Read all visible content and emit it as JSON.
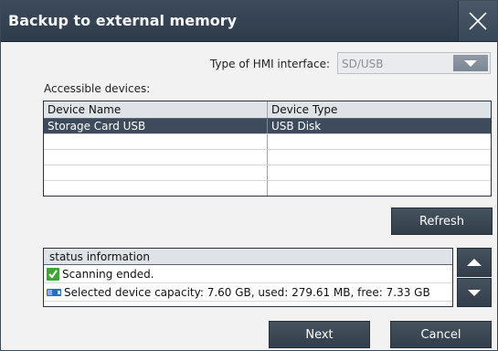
{
  "window": {
    "title": "Backup to external memory"
  },
  "hmi": {
    "label": "Type of HMI interface:",
    "value": "SD/USB"
  },
  "devices": {
    "label": "Accessible devices:",
    "columns": [
      "Device Name",
      "Device Type"
    ],
    "rows": [
      {
        "name": "Storage Card USB",
        "type": "USB Disk",
        "selected": true
      },
      {
        "name": "",
        "type": ""
      },
      {
        "name": "",
        "type": ""
      },
      {
        "name": "",
        "type": ""
      },
      {
        "name": "",
        "type": ""
      }
    ]
  },
  "buttons": {
    "refresh": "Refresh",
    "next": "Next",
    "cancel": "Cancel"
  },
  "status": {
    "header": "status information",
    "lines": [
      {
        "icon": "check-icon",
        "text": "Scanning ended."
      },
      {
        "icon": "storage-device-icon",
        "text": "Selected device capacity: 7.60 GB, used: 279.61 MB, free: 7.33 GB"
      }
    ]
  },
  "colors": {
    "titlebar": "#34414f",
    "button": "#3b4855",
    "selection": "#3d4b5c",
    "check": "#3fa535"
  }
}
